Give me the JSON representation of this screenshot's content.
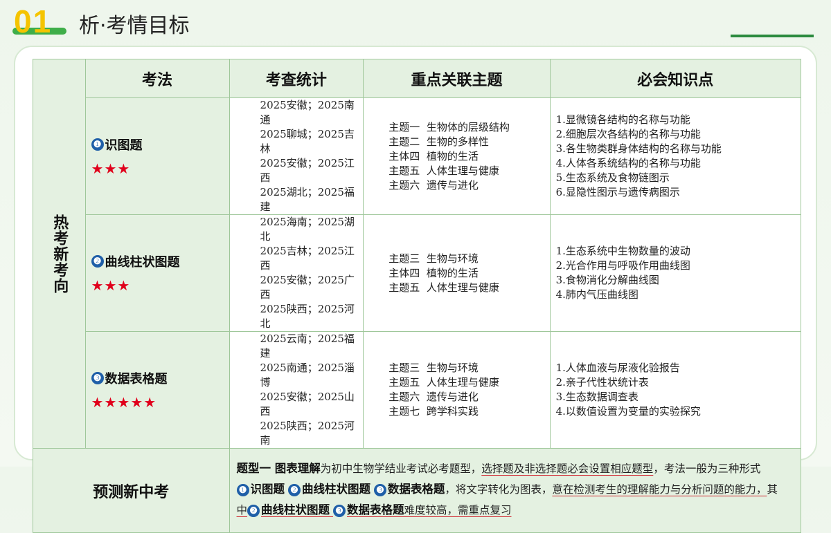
{
  "header": {
    "number": "01",
    "title": "析·考情目标"
  },
  "table": {
    "side_label": "热考新考向",
    "columns": [
      "考法",
      "考查统计",
      "重点关联主题",
      "必会知识点"
    ],
    "rows": [
      {
        "badge": "❶",
        "method": "识图题",
        "stars": "★★★",
        "stats": [
          "2025安徽；2025南通",
          "2025聊城；2025吉林",
          "2025安徽；2025江西",
          "2025湖北；2025福建"
        ],
        "topics": [
          "主题一  生物体的层级结构",
          "主题二  生物的多样性",
          "主体四  植物的生活",
          "主题五  人体生理与健康",
          "主题六  遗传与进化"
        ],
        "points": [
          "1.显微镜各结构的名称与功能",
          "2.细胞层次各结构的名称与功能",
          "3.各生物类群身体结构的名称与功能",
          "4.人体各系统结构的名称与功能",
          "5.生态系统及食物链图示",
          "6.显隐性图示与遗传病图示"
        ]
      },
      {
        "badge": "❷",
        "method": "曲线柱状图题",
        "stars": "★★★",
        "stats": [
          "2025海南；2025湖北",
          "2025吉林；2025江西",
          "2025安徽；2025广西",
          "2025陕西；2025河北"
        ],
        "topics": [
          "主题三  生物与环境",
          "主体四  植物的生活",
          "主题五  人体生理与健康"
        ],
        "points": [
          "1.生态系统中生物数量的波动",
          "2.光合作用与呼吸作用曲线图",
          "3.食物消化分解曲线图",
          "4.肺内气压曲线图"
        ]
      },
      {
        "badge": "❸",
        "method": "数据表格题",
        "stars": "★★★★★",
        "stats": [
          "2025云南；2025福建",
          "2025南通；2025淄博",
          "2025安徽；2025山西",
          "2025陕西；2025河南"
        ],
        "topics": [
          "主题三  生物与环境",
          "主题五  人体生理与健康",
          "主题六  遗传与进化",
          "主题七  跨学科实践"
        ],
        "points": [
          "1.人体血液与尿液化验报告",
          "2.亲子代性状统计表",
          "3.生态数据调查表",
          "4.以数值设置为变量的实验探究"
        ]
      }
    ]
  },
  "prediction": {
    "label": "预测新中考",
    "line1_bold": "题型一 图表理解",
    "line1_text": "为初中生物学结业考试必考题型，",
    "line1_underline": "选择题及非选择题必会设置相应题型",
    "line1_tail": "，考法一般为三种形式",
    "b1": "❶",
    "t1": "识图题",
    "b2": "❷",
    "t2": "曲线柱状图题",
    "b3": "❸",
    "t3": "数据表格题",
    "line2_text": "，将文字转化为图表，",
    "line2_underline": "意在检测考生的理解能力与分析问题的能力，",
    "line2_tail": "其",
    "line3_start": "中",
    "b4": "❷",
    "t4": "曲线柱状图题",
    "b5": "❸",
    "t5": "数据表格题",
    "line3_tail": "难度较高，需重点复习"
  }
}
